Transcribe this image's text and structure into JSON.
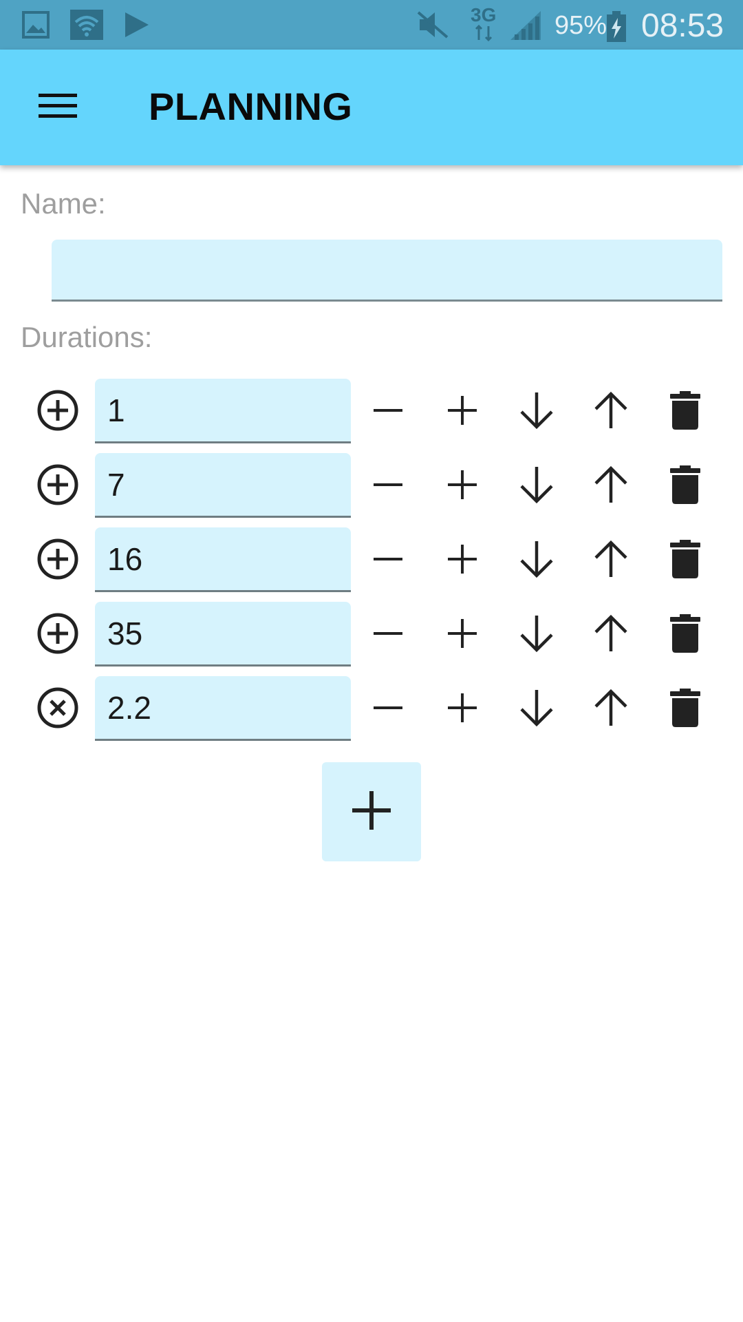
{
  "status_bar": {
    "battery_percent": "95%",
    "network_type": "3G",
    "time": "08:53",
    "icons": [
      "image-icon",
      "wifi-icon",
      "play-store-icon",
      "mute-icon",
      "network-3g-icon",
      "signal-icon",
      "battery-charging-icon"
    ]
  },
  "app_bar": {
    "menu_icon": "hamburger-menu-icon",
    "title": "PLANNING",
    "background_color": "#64d5fc"
  },
  "form": {
    "name_label": "Name:",
    "name_value": "",
    "durations_label": "Durations:"
  },
  "durations": [
    {
      "value": "1",
      "toggle_icon": "add-circle-icon"
    },
    {
      "value": "7",
      "toggle_icon": "add-circle-icon"
    },
    {
      "value": "16",
      "toggle_icon": "add-circle-icon"
    },
    {
      "value": "35",
      "toggle_icon": "add-circle-icon"
    },
    {
      "value": "2.2",
      "toggle_icon": "multiply-circle-icon"
    }
  ],
  "row_action_icons": [
    "minus-icon",
    "plus-icon",
    "arrow-down-icon",
    "arrow-up-icon",
    "delete-icon"
  ],
  "add_button_icon": "plus-icon",
  "colors": {
    "status_bar": "#4fa3c4",
    "input_background": "#d6f3fd",
    "label_gray": "#9e9e9e",
    "icon_dark": "#222222"
  }
}
